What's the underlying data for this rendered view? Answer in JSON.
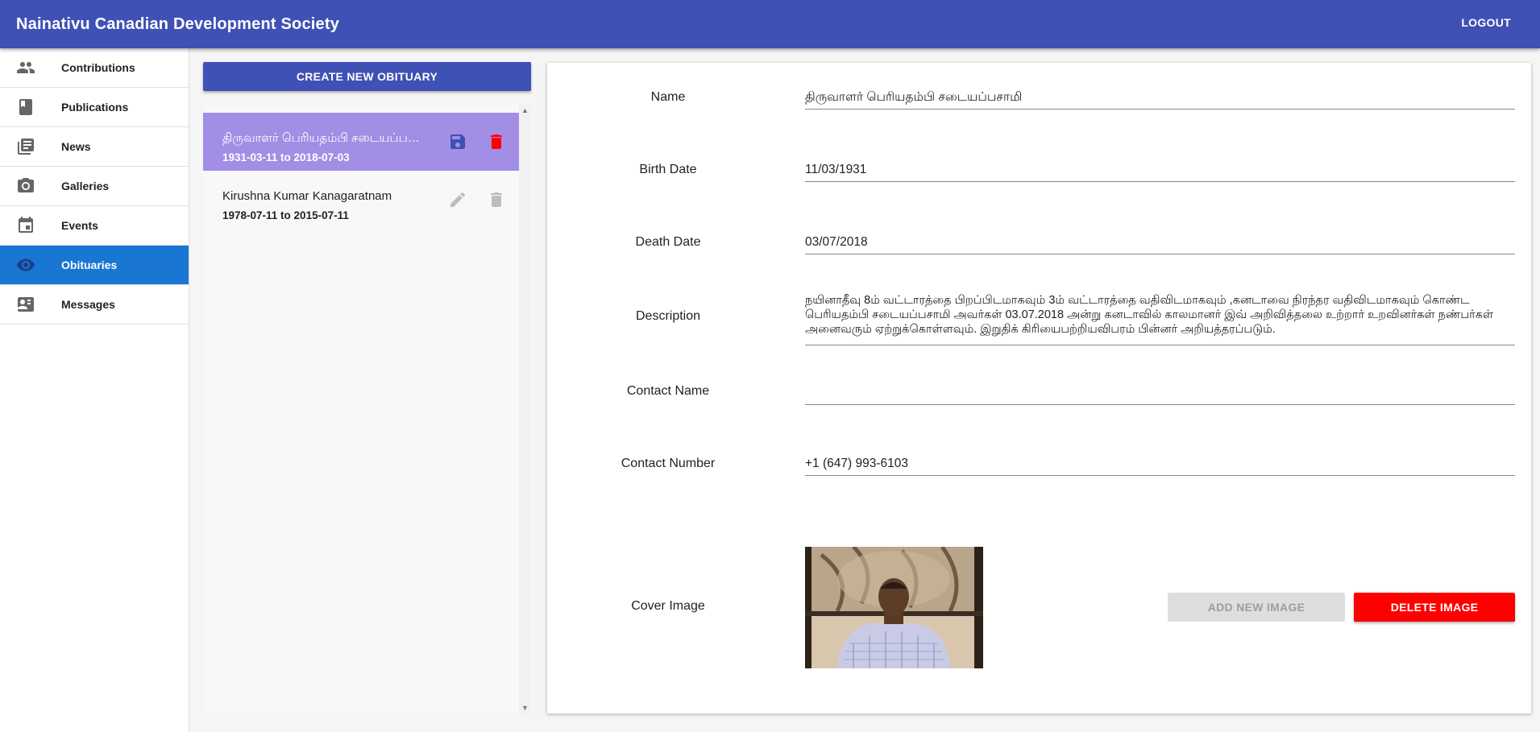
{
  "app": {
    "title": "Nainativu Canadian Development Society",
    "logout_label": "LOGOUT"
  },
  "sidebar": {
    "items": [
      {
        "label": "Contributions",
        "icon": "people-icon"
      },
      {
        "label": "Publications",
        "icon": "book-icon"
      },
      {
        "label": "News",
        "icon": "news-icon"
      },
      {
        "label": "Galleries",
        "icon": "camera-icon"
      },
      {
        "label": "Events",
        "icon": "calendar-icon"
      },
      {
        "label": "Obituaries",
        "icon": "eye-icon",
        "active": true
      },
      {
        "label": "Messages",
        "icon": "contact-card-icon"
      }
    ]
  },
  "list": {
    "create_label": "CREATE NEW OBITUARY",
    "items": [
      {
        "name": "திருவாளர் பெரியதம்பி சடையப்பசாமி",
        "dates": "1931-03-11 to 2018-07-03",
        "selected": true,
        "actions": [
          "save-icon",
          "delete-icon"
        ]
      },
      {
        "name": "Kirushna Kumar Kanagaratnam",
        "dates": "1978-07-11 to 2015-07-11",
        "selected": false,
        "actions": [
          "edit-icon",
          "delete-icon"
        ]
      }
    ]
  },
  "form": {
    "name": {
      "label": "Name",
      "value": "திருவாளர் பெரியதம்பி சடையப்பசாமி"
    },
    "birth_date": {
      "label": "Birth Date",
      "value": "11/03/1931"
    },
    "death_date": {
      "label": "Death Date",
      "value": "03/07/2018"
    },
    "description": {
      "label": "Description",
      "value": "நயினாதீவு 8ம் வட்டாரத்தை பிறப்பிடமாகவும் 3ம் வட்டாரத்தை வதிவிடமாகவும் ,கனடாவை நிரந்தர வதிவிடமாகவும் கொண்ட பெரியதம்பி சடையப்பசாமி அவர்கள் 03.07.2018 அன்று கனடாவில் காலமானர் இவ் அறிவித்தலை உற்றார் உறவினர்கள் நண்பர்கள் அனைவரும் ஏற்றுக்கொள்ளவும். இறுதிக் கிரியைபற்றியவிபரம் பின்னர் அறியத்தரப்படும்."
    },
    "contact_name": {
      "label": "Contact Name",
      "value": ""
    },
    "contact_number": {
      "label": "Contact Number",
      "value": "+1 (647) 993-6103"
    },
    "cover_image": {
      "label": "Cover Image",
      "add_label": "ADD NEW IMAGE",
      "delete_label": "DELETE IMAGE"
    }
  },
  "colors": {
    "primary": "#3f51b5",
    "active_nav": "#1976d2",
    "selected_item": "#a28ee5",
    "danger": "#ff0000"
  }
}
